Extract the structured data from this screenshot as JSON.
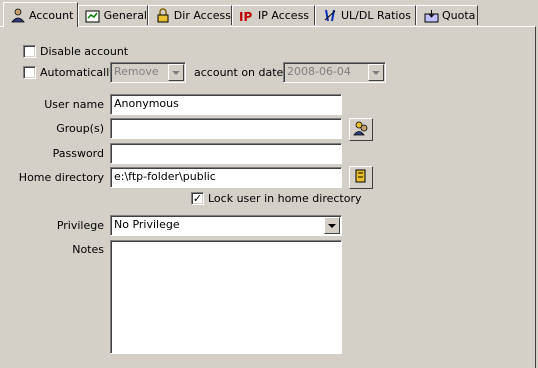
{
  "tabs": [
    {
      "label": "Account",
      "icon": "user-icon",
      "active": true
    },
    {
      "label": "General",
      "icon": "notepad-icon"
    },
    {
      "label": "Dir Access",
      "icon": "lock-icon"
    },
    {
      "label": "IP Access",
      "icon": "ip-icon"
    },
    {
      "label": "UL/DL Ratios",
      "icon": "ratio-icon"
    },
    {
      "label": "Quota",
      "icon": "quota-icon"
    }
  ],
  "form": {
    "disable_account": {
      "label": "Disable account",
      "checked": false
    },
    "automatically": {
      "label": "Automatically",
      "checked": false
    },
    "auto_action": {
      "value": "Remove"
    },
    "account_on_date_label": "account on date",
    "auto_date": {
      "value": "2008-06-04"
    },
    "user_name": {
      "label": "User name",
      "value": "Anonymous"
    },
    "groups": {
      "label": "Group(s)",
      "value": ""
    },
    "password": {
      "label": "Password",
      "value": ""
    },
    "home_directory": {
      "label": "Home directory",
      "value": "e:\\ftp-folder\\public"
    },
    "lock_home": {
      "label": "Lock user in home directory",
      "checked": true,
      "mark": "✓"
    },
    "privilege": {
      "label": "Privilege",
      "value": "No Privilege"
    },
    "notes": {
      "label": "Notes",
      "value": ""
    }
  }
}
